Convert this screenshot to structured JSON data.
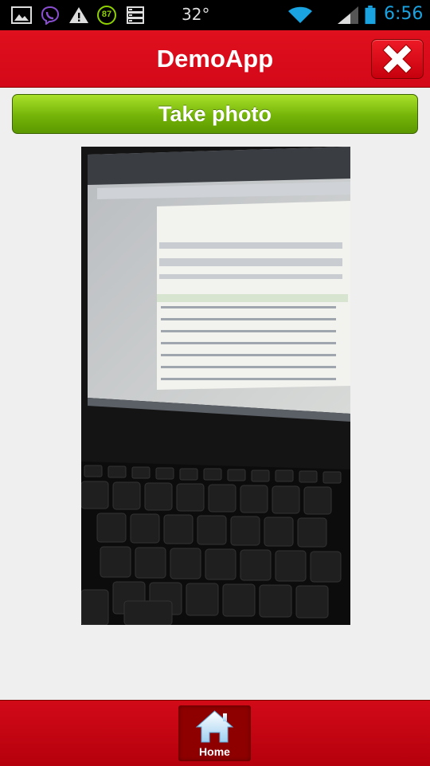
{
  "status_bar": {
    "temperature": "32°",
    "time": "6:56",
    "notification_count": "87"
  },
  "app": {
    "title": "DemoApp"
  },
  "take_photo_label": "Take photo",
  "photo": {
    "description_icon": "captured-photo"
  },
  "tabbar": {
    "home_label": "Home"
  },
  "colors": {
    "header_red": "#d30818",
    "button_green": "#74b408",
    "tab_active": "#8e0000"
  }
}
